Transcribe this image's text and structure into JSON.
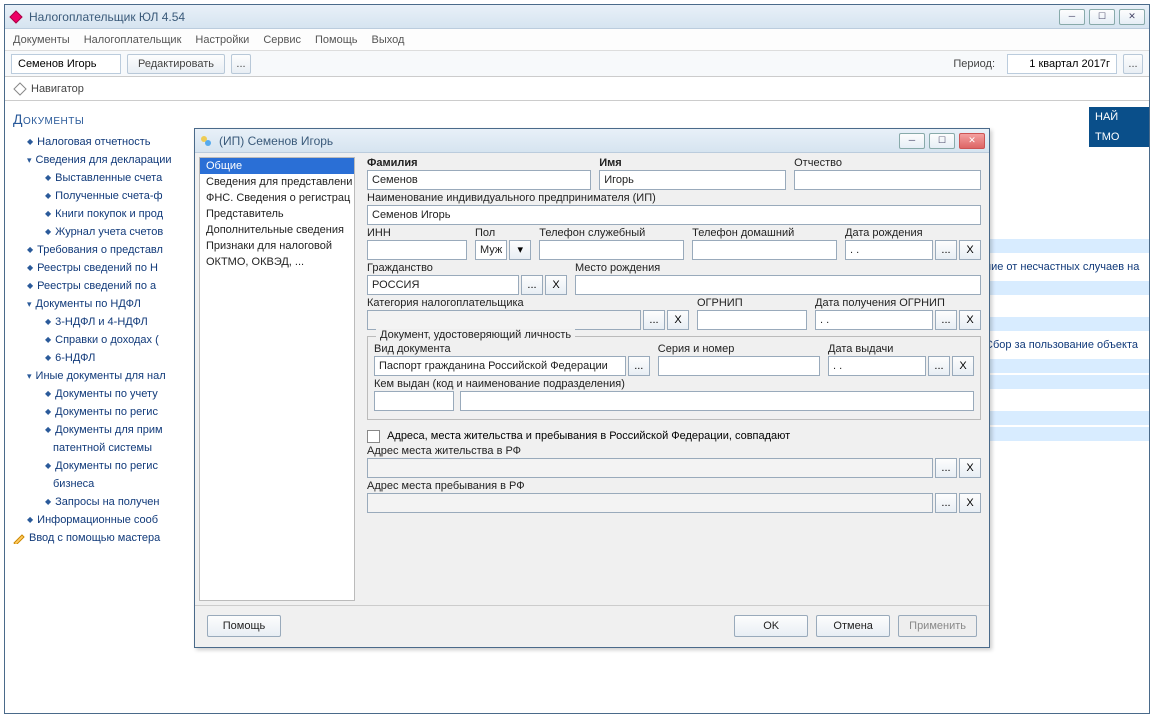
{
  "app": {
    "title": "Налогоплательщик ЮЛ 4.54",
    "menu": [
      "Документы",
      "Налогоплательщик",
      "Настройки",
      "Сервис",
      "Помощь",
      "Выход"
    ],
    "toolbar": {
      "name": "Семенов Игорь",
      "edit": "Редактировать",
      "period_label": "Период:",
      "period_value": "1 квартал 2017г"
    },
    "navigator": "Навигатор"
  },
  "sidebar": {
    "heading": "Документы",
    "items": [
      {
        "t": "leaf1",
        "label": "Налоговая отчетность"
      },
      {
        "t": "branch",
        "label": "Сведения для декларации"
      },
      {
        "t": "leaf2",
        "label": "Выставленные счета"
      },
      {
        "t": "leaf2",
        "label": "Полученные счета-ф"
      },
      {
        "t": "leaf2",
        "label": "Книги покупок и прод"
      },
      {
        "t": "leaf2",
        "label": "Журнал учета счетов"
      },
      {
        "t": "leaf1",
        "label": "Требования о представл"
      },
      {
        "t": "leaf1",
        "label": "Реестры сведений по Н"
      },
      {
        "t": "leaf1",
        "label": "Реестры сведений по а"
      },
      {
        "t": "branch",
        "label": "Документы по НДФЛ"
      },
      {
        "t": "leaf2",
        "label": "3-НДФЛ и 4-НДФЛ"
      },
      {
        "t": "leaf2",
        "label": "Справки о доходах ("
      },
      {
        "t": "leaf2",
        "label": "6-НДФЛ"
      },
      {
        "t": "branch",
        "label": "Иные документы для нал"
      },
      {
        "t": "leaf2",
        "label": "Документы по учету"
      },
      {
        "t": "leaf2",
        "label": "Документы по регис"
      },
      {
        "t": "leaf2w",
        "label": "Документы для прим",
        "sub": "патентной системы"
      },
      {
        "t": "leaf2w",
        "label": "Документы по регис",
        "sub": "бизнеса"
      },
      {
        "t": "leaf2",
        "label": "Запросы на получен"
      },
      {
        "t": "leaf1",
        "label": "Информационные сооб"
      },
      {
        "t": "wizard",
        "label": "Ввод с помощью мастера"
      }
    ]
  },
  "rightpanel": {
    "box1": "НАЙ",
    "box2": "ТМО",
    "link1": "ние от несчастных случаев на",
    "link2": "Сбор за пользование объекта"
  },
  "modal": {
    "title": "(ИП) Семенов Игорь",
    "nav": [
      "Общие",
      "Сведения для представлени",
      "ФНС. Сведения о регистрац",
      "Представитель",
      "Дополнительные сведения",
      "   Признаки для налоговой",
      "ОКТМО, ОКВЭД, ..."
    ],
    "labels": {
      "lastname": "Фамилия",
      "firstname": "Имя",
      "patronymic": "Отчество",
      "ipname": "Наименование индивидуального предпринимателя (ИП)",
      "inn": "ИНН",
      "sex": "Пол",
      "workphone": "Телефон служебный",
      "homephone": "Телефон домашний",
      "birthdate": "Дата рождения",
      "citizenship": "Гражданство",
      "birthplace": "Место рождения",
      "category": "Категория налогоплательщика",
      "ogrnip": "ОГРНИП",
      "ogrnipdate": "Дата получения ОГРНИП",
      "docgroup": "Документ, удостоверяющий личность",
      "doctype": "Вид документа",
      "docnum": "Серия и номер",
      "docdate": "Дата выдачи",
      "issuedby": "Кем выдан (код и наименование подразделения)",
      "addrsame": "Адреса, места жительства и пребывания в Российской Федерации, совпадают",
      "addrlive": "Адрес места жительства в РФ",
      "addrstay": "Адрес места пребывания в РФ"
    },
    "values": {
      "lastname": "Семенов",
      "firstname": "Игорь",
      "patronymic": "",
      "ipname": "Семенов Игорь",
      "inn": "",
      "sex": "Муж",
      "workphone": "",
      "homephone": "",
      "birthdate": " .  . ",
      "citizenship": "РОССИЯ",
      "birthplace": "",
      "category": "",
      "ogrnip": "",
      "ogrnipdate": " .  . ",
      "doctype": "Паспорт гражданина Российской Федерации",
      "docnum": "",
      "docdate": " .  . ",
      "issuedby_code": "",
      "issuedby_name": "",
      "addrlive": "",
      "addrstay": ""
    },
    "buttons": {
      "help": "Помощь",
      "ok": "OK",
      "cancel": "Отмена",
      "apply": "Применить",
      "browse": "...",
      "clear": "X",
      "dd": "▾"
    }
  }
}
